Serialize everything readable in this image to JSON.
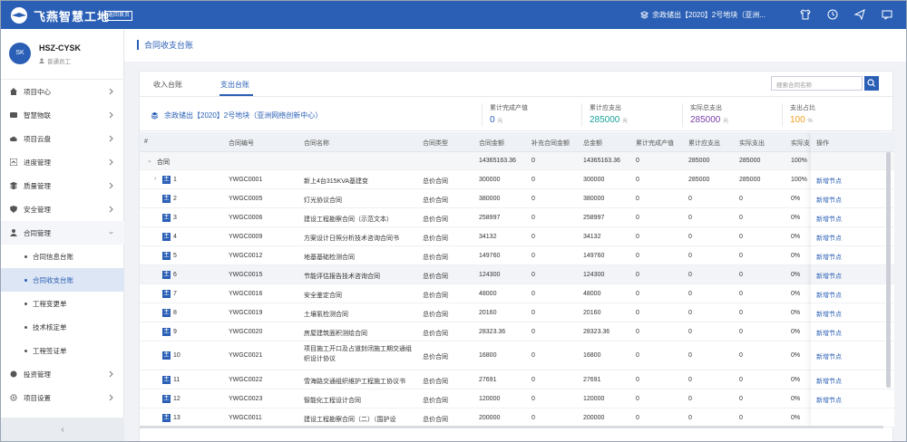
{
  "topbar": {
    "brand": "飞燕智慧工地",
    "back_label": "返回首页",
    "project": "余政储出【2020】2号地块（亚洲..."
  },
  "user": {
    "avatar": "SK",
    "name": "HSZ-CYSK",
    "role": "普通员工"
  },
  "menu": [
    {
      "label": "项目中心",
      "icon": "home-icon"
    },
    {
      "label": "智慧物联",
      "icon": "iot-icon"
    },
    {
      "label": "项目云盘",
      "icon": "cloud-icon"
    },
    {
      "label": "进度管理",
      "icon": "progress-icon"
    },
    {
      "label": "质量管理",
      "icon": "quality-icon"
    },
    {
      "label": "安全管理",
      "icon": "shield-icon"
    },
    {
      "label": "合同管理",
      "icon": "contract-icon"
    }
  ],
  "submenu": [
    "合同信息台账",
    "合同收支台账",
    "工程变更单",
    "技术核定单",
    "工程签证单"
  ],
  "menu_after": [
    {
      "label": "投资管理",
      "icon": "money-icon"
    },
    {
      "label": "项目设置",
      "icon": "gear-icon"
    }
  ],
  "page_title": "合同收支台账",
  "tabs": [
    "收入台账",
    "支出台账"
  ],
  "search_placeholder": "搜索合同名称",
  "summary": {
    "title": "余政储出【2020】2号地块（亚洲网络创新中心）",
    "stats": [
      {
        "label": "累计完成产值",
        "value": "0",
        "unit": "元",
        "color": "#2a5fb5"
      },
      {
        "label": "累计应支出",
        "value": "285000",
        "unit": "元",
        "color": "#1aa39a"
      },
      {
        "label": "实际总支出",
        "value": "285000",
        "unit": "元",
        "color": "#7a3fa8"
      },
      {
        "label": "支出占比",
        "value": "100",
        "unit": "%",
        "color": "#f0a020"
      }
    ]
  },
  "columns": [
    "#",
    "合同编号",
    "合同名称",
    "合同类型",
    "合同金额",
    "补充合同金额",
    "总金额",
    "累计完成产值",
    "累计应支出",
    "实际支出",
    "实际支",
    "操作"
  ],
  "group_row": {
    "label": "合同",
    "amount": "14365163.36",
    "supp": "0",
    "total": "14365163.36",
    "done": "0",
    "due": "285000",
    "paid": "285000",
    "ratio": "100%"
  },
  "rows": [
    {
      "no": "1",
      "code": "YWGC0001",
      "name": "新上4台315KVA基建变",
      "type": "总价合同",
      "amount": "300000",
      "supp": "0",
      "total": "300000",
      "done": "0",
      "due": "285000",
      "paid": "285000",
      "ratio": "100%",
      "op": "新增节点"
    },
    {
      "no": "2",
      "code": "YWGC0005",
      "name": "灯光协议合同",
      "type": "总价合同",
      "amount": "380000",
      "supp": "0",
      "total": "380000",
      "done": "0",
      "due": "0",
      "paid": "0",
      "ratio": "0%",
      "op": "新增节点"
    },
    {
      "no": "3",
      "code": "YWGC0006",
      "name": "建设工程勘察合同（示范文本）",
      "type": "总价合同",
      "amount": "258997",
      "supp": "0",
      "total": "258997",
      "done": "0",
      "due": "0",
      "paid": "0",
      "ratio": "0%",
      "op": "新增节点"
    },
    {
      "no": "4",
      "code": "YWGC0009",
      "name": "方案设计日照分析技术咨询合同书",
      "type": "总价合同",
      "amount": "34132",
      "supp": "0",
      "total": "34132",
      "done": "0",
      "due": "0",
      "paid": "0",
      "ratio": "0%",
      "op": "新增节点"
    },
    {
      "no": "5",
      "code": "YWGC0012",
      "name": "地基基础检测合同",
      "type": "总价合同",
      "amount": "149760",
      "supp": "0",
      "total": "149760",
      "done": "0",
      "due": "0",
      "paid": "0",
      "ratio": "0%",
      "op": "新增节点"
    },
    {
      "no": "6",
      "code": "YWGC0015",
      "name": "节能评估报告技术咨询合同",
      "type": "总价合同",
      "amount": "124300",
      "supp": "0",
      "total": "124300",
      "done": "0",
      "due": "0",
      "paid": "0",
      "ratio": "0%",
      "op": "新增节点"
    },
    {
      "no": "7",
      "code": "YWGC0016",
      "name": "安全鉴定合同",
      "type": "总价合同",
      "amount": "48000",
      "supp": "0",
      "total": "48000",
      "done": "0",
      "due": "0",
      "paid": "0",
      "ratio": "0%",
      "op": "新增节点"
    },
    {
      "no": "8",
      "code": "YWGC0019",
      "name": "土壤氡检测合同",
      "type": "总价合同",
      "amount": "20160",
      "supp": "0",
      "total": "20160",
      "done": "0",
      "due": "0",
      "paid": "0",
      "ratio": "0%",
      "op": "新增节点"
    },
    {
      "no": "9",
      "code": "YWGC0020",
      "name": "房屋建筑面积测绘合同",
      "type": "总价合同",
      "amount": "28323.36",
      "supp": "0",
      "total": "28323.36",
      "done": "0",
      "due": "0",
      "paid": "0",
      "ratio": "0%",
      "op": "新增节点"
    },
    {
      "no": "10",
      "code": "YWGC0021",
      "name": "项目施工开口及占道封闭施工期交通组织设计协议",
      "type": "总价合同",
      "amount": "16800",
      "supp": "0",
      "total": "16800",
      "done": "0",
      "due": "0",
      "paid": "0",
      "ratio": "0%",
      "op": "新增节点"
    },
    {
      "no": "11",
      "code": "YWGC0022",
      "name": "雪海路交通组织维护工程施工协议书",
      "type": "总价合同",
      "amount": "27691",
      "supp": "0",
      "total": "27691",
      "done": "0",
      "due": "0",
      "paid": "0",
      "ratio": "0%",
      "op": "新增节点"
    },
    {
      "no": "12",
      "code": "YWGC0023",
      "name": "智能化工程设计合同",
      "type": "总价合同",
      "amount": "120000",
      "supp": "0",
      "total": "120000",
      "done": "0",
      "due": "0",
      "paid": "0",
      "ratio": "0%",
      "op": "新增节点"
    },
    {
      "no": "13",
      "code": "YWGC0011",
      "name": "建设工程勘察合同（二）（围护设",
      "type": "总价合同",
      "amount": "200000",
      "supp": "0",
      "total": "200000",
      "done": "0",
      "due": "0",
      "paid": "0",
      "ratio": "0%",
      "op": ""
    }
  ],
  "colors": {
    "brand": "#2a5fb5"
  }
}
